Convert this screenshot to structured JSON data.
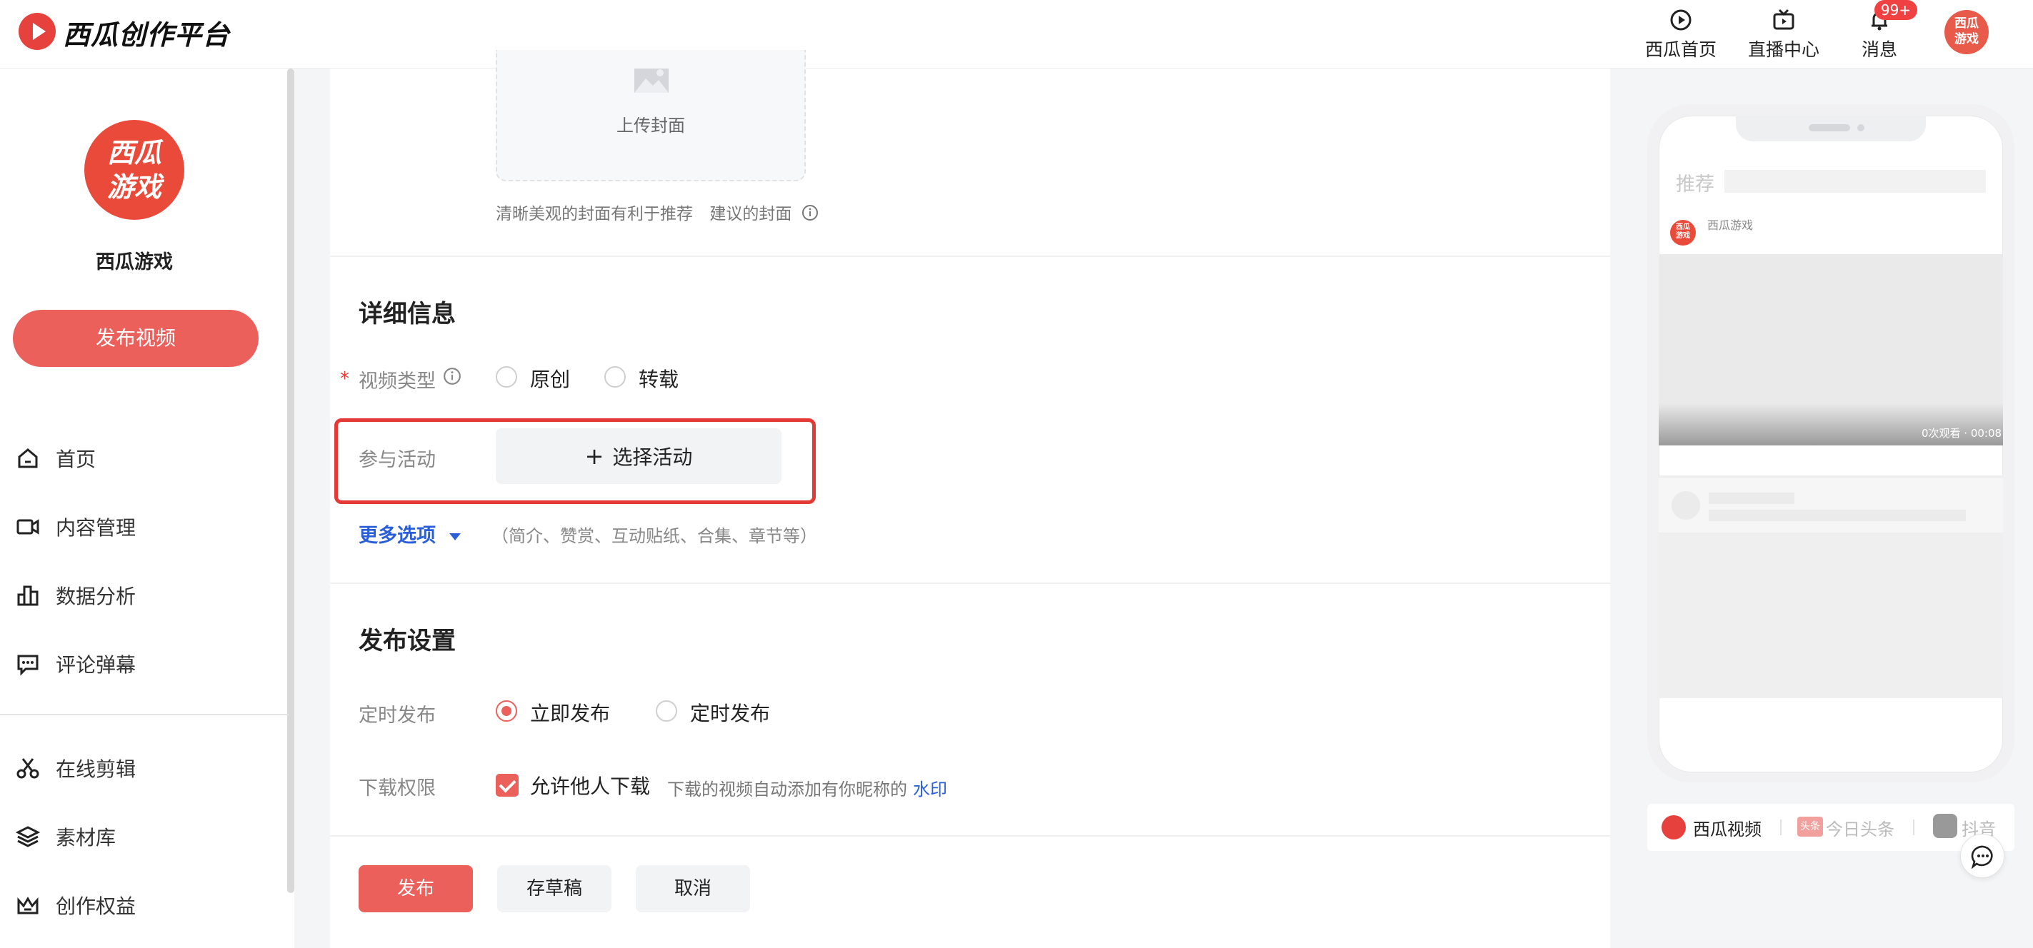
{
  "header": {
    "logo_text": "西瓜创作平台",
    "nav": [
      {
        "label": "西瓜首页",
        "icon": "play-circle-icon"
      },
      {
        "label": "直播中心",
        "icon": "tv-icon"
      },
      {
        "label": "消息",
        "icon": "bell-icon",
        "badge": "99+"
      }
    ],
    "avatar_text": "西瓜\n游戏"
  },
  "sidebar": {
    "avatar_text": "西瓜\n游戏",
    "channel_name": "西瓜游戏",
    "publish_button": "发布视频",
    "items": [
      {
        "label": "首页",
        "icon": "home-icon"
      },
      {
        "label": "内容管理",
        "icon": "video-camera-icon"
      },
      {
        "label": "数据分析",
        "icon": "bar-chart-icon"
      },
      {
        "label": "评论弹幕",
        "icon": "comment-icon"
      },
      {
        "label": "在线剪辑",
        "icon": "scissors-icon"
      },
      {
        "label": "素材库",
        "icon": "layers-icon"
      },
      {
        "label": "创作权益",
        "icon": "crown-icon"
      }
    ]
  },
  "cover": {
    "upload_label": "上传封面",
    "hint": "清晰美观的封面有利于推荐",
    "suggest_link": "建议的封面"
  },
  "details": {
    "title": "详细信息",
    "video_type": {
      "required_mark": "*",
      "label": "视频类型",
      "options": [
        "原创",
        "转载"
      ]
    },
    "activity": {
      "label": "参与活动",
      "button": "选择活动"
    },
    "more_options": "更多选项",
    "more_options_hint": "（简介、赞赏、互动贴纸、合集、章节等）"
  },
  "publish_settings": {
    "title": "发布设置",
    "schedule": {
      "label": "定时发布",
      "options": [
        "立即发布",
        "定时发布"
      ],
      "selected": "立即发布"
    },
    "download": {
      "label": "下载权限",
      "checkbox_label": "允许他人下载",
      "checked": true,
      "hint": "下载的视频自动添加有你昵称的",
      "link": "水印"
    }
  },
  "actions": {
    "publish": "发布",
    "draft": "存草稿",
    "cancel": "取消"
  },
  "preview": {
    "search_label": "推荐",
    "channel_name": "西瓜游戏",
    "avatar_text": "西瓜\n游戏",
    "video_meta": "0次观看 · 00:08",
    "platforms": [
      "西瓜视频",
      "今日头条",
      "抖音"
    ],
    "toutiao_badge": "头条"
  },
  "colors": {
    "accent": "#ec605c",
    "link": "#2b5fd9",
    "highlight": "#e53935"
  }
}
